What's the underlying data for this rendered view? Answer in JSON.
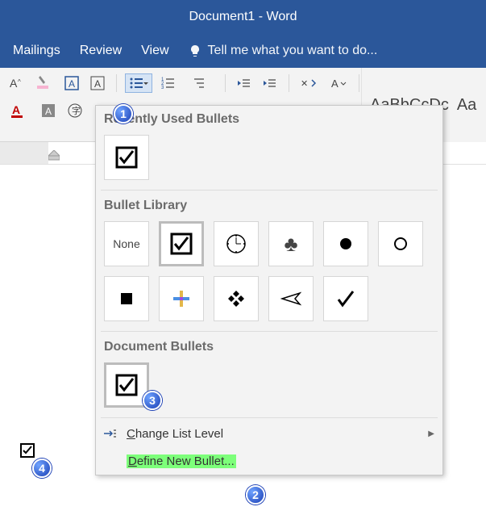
{
  "title": "Document1 - Word",
  "tabs": {
    "mailings": "Mailings",
    "review": "Review",
    "view": "View",
    "tell": "Tell me what you want to do..."
  },
  "styles": {
    "preview1": "AaBbCcDc",
    "preview2": "Aa"
  },
  "dropdown": {
    "recent_title": "Recently Used Bullets",
    "library_title": "Bullet Library",
    "document_title": "Document Bullets",
    "none_label": "None",
    "change_level": "Change List Level",
    "define_new": "Define New Bullet..."
  },
  "badges": {
    "b1": "1",
    "b2": "2",
    "b3": "3",
    "b4": "4"
  }
}
